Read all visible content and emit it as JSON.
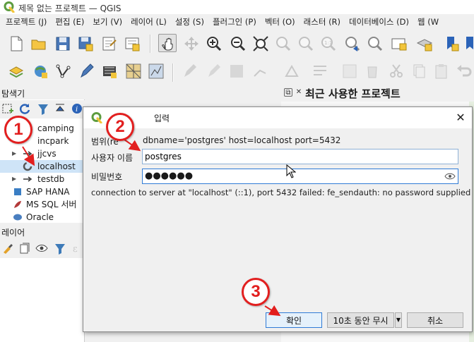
{
  "window": {
    "title": "제목 없는 프로젝트 — QGIS"
  },
  "menu": [
    "프로젝트 (J)",
    "편집 (E)",
    "보기 (V)",
    "레이어 (L)",
    "설정 (S)",
    "플러그인 (P)",
    "벡터 (O)",
    "래스터 (R)",
    "데이터베이스 (D)",
    "웹 (W"
  ],
  "browser": {
    "title": "탐색기",
    "items": [
      {
        "label": "camping",
        "expanded": false
      },
      {
        "label": "incpark",
        "expanded": false
      },
      {
        "label": "jjcvs",
        "expanded": false
      },
      {
        "label": "localhost",
        "expanded": false
      },
      {
        "label": "testdb",
        "expanded": false
      },
      {
        "label": "SAP HANA"
      },
      {
        "label": "MS SQL 서버"
      },
      {
        "label": "Oracle"
      }
    ]
  },
  "layers": {
    "title": "레이어"
  },
  "recent": {
    "title": "최근 사용한 프로젝트"
  },
  "dialog": {
    "title_visible": "입력",
    "realm_label": "범위(re",
    "realm_value": "dbname='postgres' host=localhost port=5432",
    "username_label": "사용자 이름",
    "username_value": "postgres",
    "password_label": "비밀번호",
    "password_dots": "●●●●●●",
    "error": "connection to server at \"localhost\" (::1), port 5432 failed: fe_sendauth: no password supplied",
    "ok_label": "확인",
    "ignore_label": "10초 동안 무시",
    "cancel_label": "취소"
  },
  "annotations": [
    "1",
    "2",
    "3"
  ],
  "colors": {
    "annotation_red": "#e21f1f",
    "qgis_green": "#5d9c3f",
    "qgis_yellow": "#f2c53b",
    "selection": "#cfe4f7"
  }
}
